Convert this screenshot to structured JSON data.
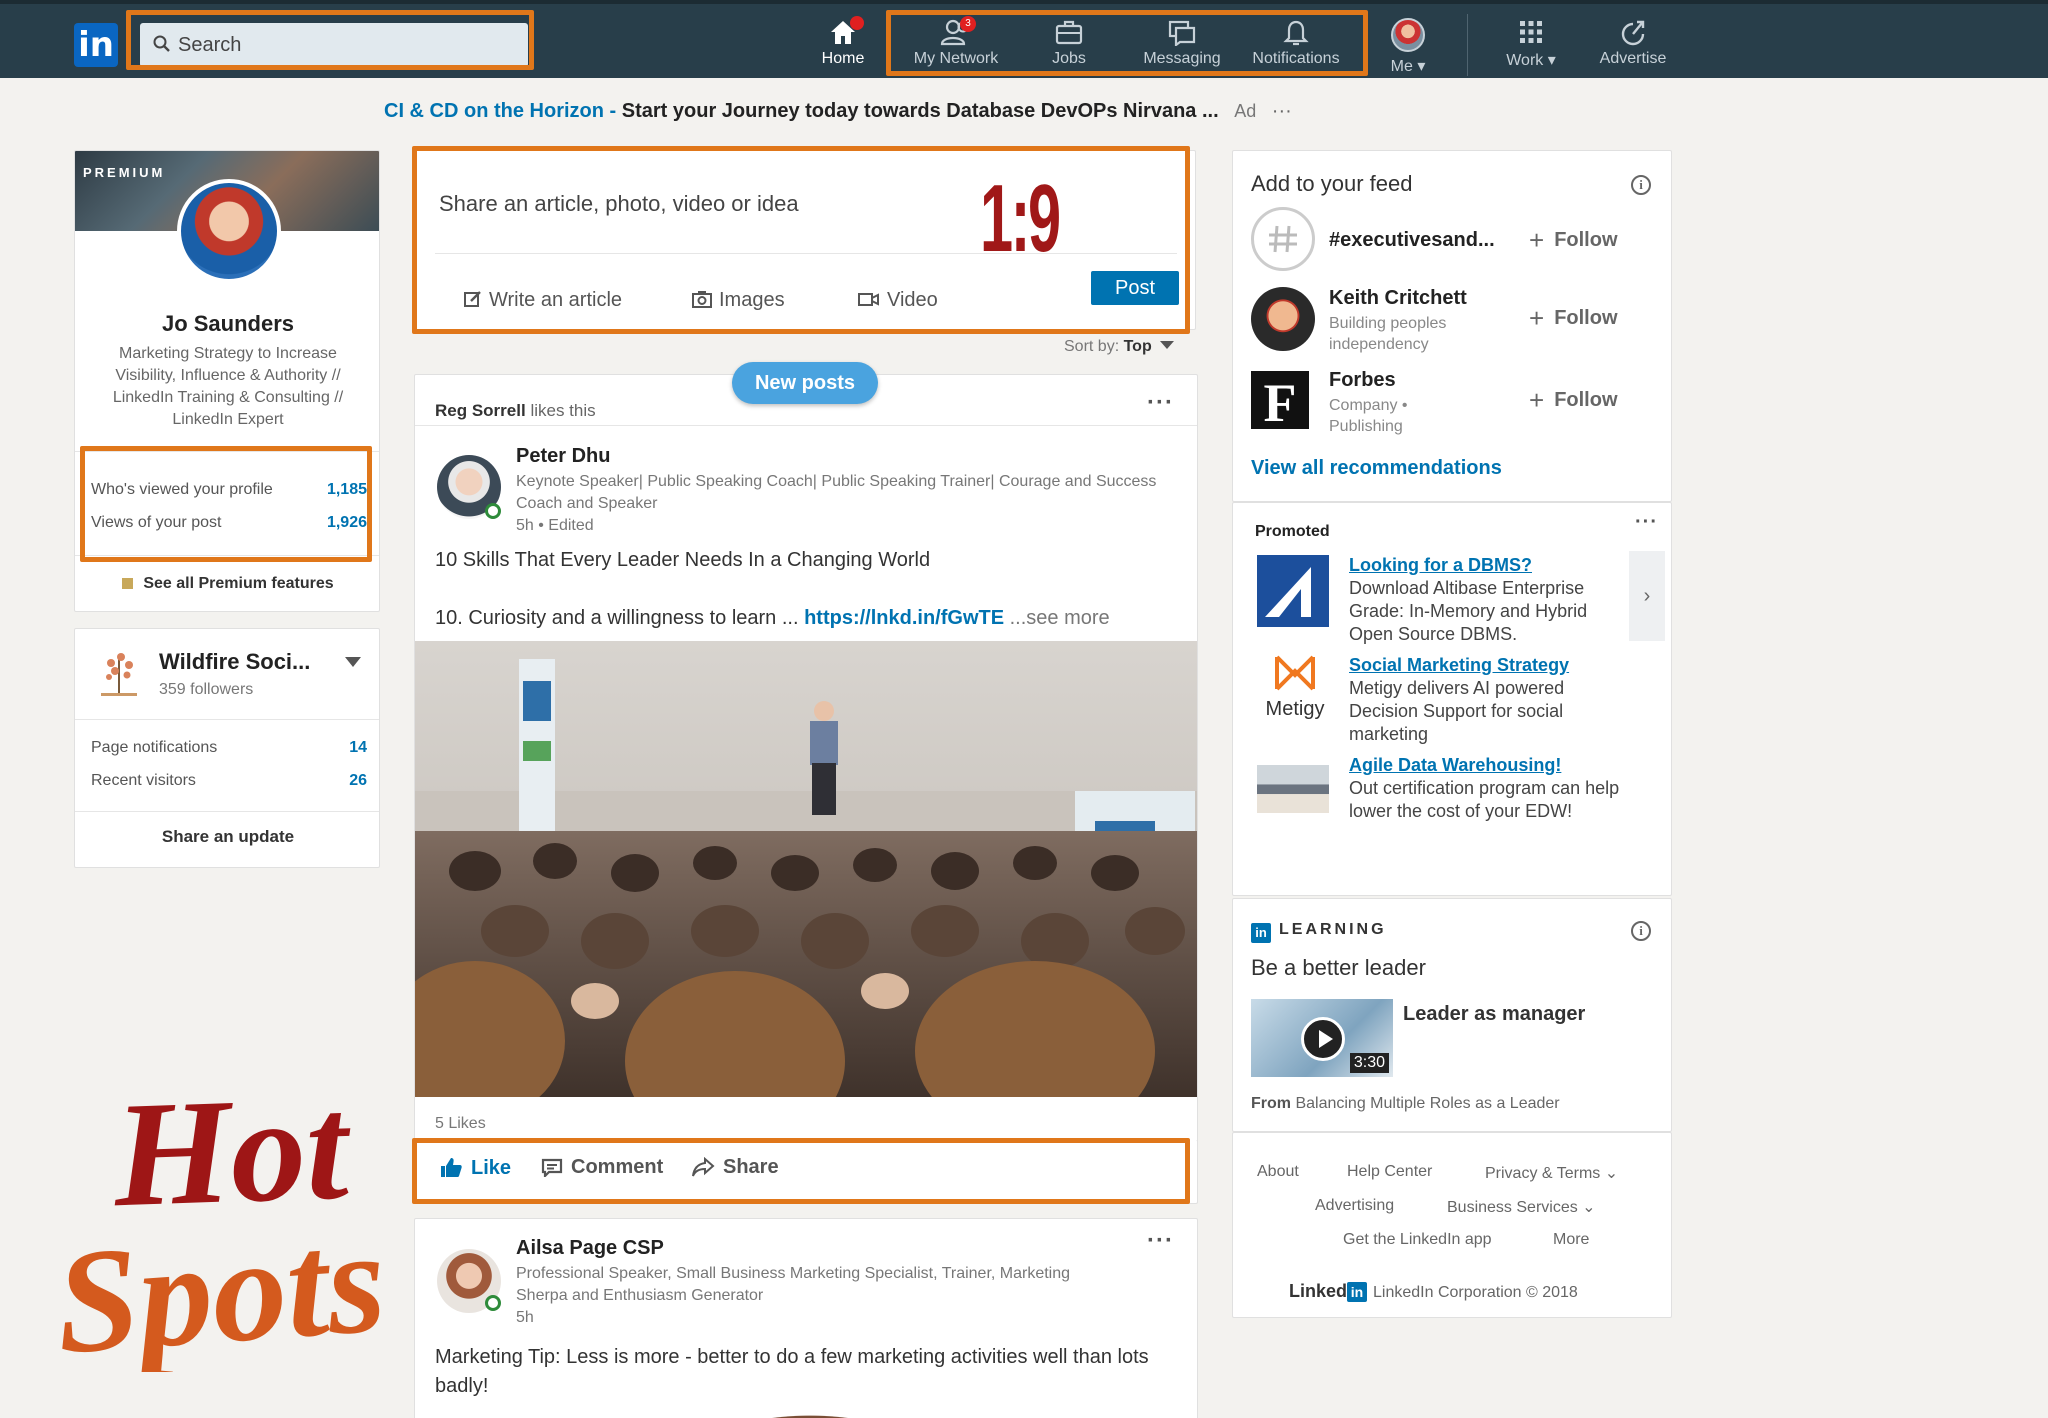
{
  "nav": {
    "logo": "in",
    "search_placeholder": "Search",
    "items": [
      {
        "label": "Home",
        "badge": ""
      },
      {
        "label": "My Network",
        "badge": "3"
      },
      {
        "label": "Jobs",
        "badge": ""
      },
      {
        "label": "Messaging",
        "badge": ""
      },
      {
        "label": "Notifications",
        "badge": ""
      },
      {
        "label": "Me",
        "badge": ""
      },
      {
        "label": "Work",
        "badge": ""
      },
      {
        "label": "Advertise",
        "badge": ""
      }
    ]
  },
  "ad_banner": {
    "link": "CI & CD on the Horizon",
    "separator": " - ",
    "text": "Start your Journey today towards Database DevOPs Nirvana ...",
    "ad": "Ad",
    "more": "···"
  },
  "profile": {
    "premium": "PREMIUM",
    "name": "Jo Saunders",
    "headline": "Marketing Strategy to Increase Visibility, Influence & Authority // LinkedIn Training & Consulting // LinkedIn Expert",
    "stats": [
      {
        "label": "Who's viewed your profile",
        "value": "1,185"
      },
      {
        "label": "Views of your post",
        "value": "1,926"
      }
    ],
    "premium_link": "See all Premium features"
  },
  "page_card": {
    "name": "Wildfire Soci...",
    "followers": "359 followers",
    "stats": [
      {
        "label": "Page notifications",
        "value": "14"
      },
      {
        "label": "Recent visitors",
        "value": "26"
      }
    ],
    "share_update": "Share an update"
  },
  "share_box": {
    "prompt": "Share an article, photo, video or idea",
    "write_article": "Write an article",
    "images": "Images",
    "video": "Video",
    "post": "Post"
  },
  "annotation": {
    "ratio": "1:9",
    "hot": "Hot",
    "spots": "Spots"
  },
  "feed": {
    "sort_label": "Sort by:",
    "sort_value": "Top",
    "new_posts": "New posts",
    "post1": {
      "liker": "Reg Sorrell",
      "likes_this": "likes this",
      "author": "Peter Dhu",
      "headline": "Keynote Speaker| Public Speaking Coach| Public Speaking Trainer| Courage and Success Coach and Speaker",
      "meta": "5h • Edited",
      "line1": "10 Skills That Every Leader Needs In a Changing World",
      "line2": "10.   Curiosity and a willingness to learn  ...",
      "link": "https://lnkd.in/fGwTE",
      "see_more": "...see more",
      "likes": "5 Likes",
      "like": "Like",
      "comment": "Comment",
      "share": "Share"
    },
    "post2": {
      "author": "Ailsa Page CSP",
      "headline": "Professional Speaker, Small Business Marketing Specialist, Trainer, Marketing Sherpa and Enthusiasm Generator",
      "meta": "5h",
      "text": "Marketing Tip: Less is more - better to do a few marketing activities well than lots badly!"
    }
  },
  "feed_recs": {
    "title": "Add to your feed",
    "items": [
      {
        "name": "#executivesand...",
        "sub": "",
        "follow": "Follow"
      },
      {
        "name": "Keith Critchett",
        "sub": "Building peoples independency",
        "follow": "Follow"
      },
      {
        "name": "Forbes",
        "sub": "Company • Publishing",
        "follow": "Follow"
      }
    ],
    "view_all": "View all recommendations"
  },
  "promoted": {
    "title": "Promoted",
    "more": "···",
    "items": [
      {
        "title": "Looking for a DBMS?",
        "desc": "Download Altibase Enterprise Grade: In-Memory and Hybrid Open Source DBMS."
      },
      {
        "title": "Social Marketing Strategy",
        "desc": "Metigy delivers AI powered Decision Support for social marketing",
        "logo_text": "Metigy"
      },
      {
        "title": "Agile Data Warehousing!",
        "desc": "Out certification program can help lower the cost of your EDW!"
      }
    ]
  },
  "learning": {
    "label": "LEARNING",
    "title": "Be a better leader",
    "course": "Leader as manager",
    "duration": "3:30",
    "from_prefix": "From",
    "from_course": "Balancing Multiple Roles as a Leader"
  },
  "footer": {
    "links": [
      "About",
      "Help Center",
      "Privacy & Terms",
      "Advertising",
      "Business Services",
      "Get the LinkedIn app",
      "More"
    ],
    "brand": "Linked",
    "copyright": "LinkedIn Corporation © 2018"
  },
  "colors": {
    "nav_bg": "#283e4a",
    "accent": "#0073b1",
    "highlight": "#e0771a",
    "annotation": "#a01818"
  }
}
